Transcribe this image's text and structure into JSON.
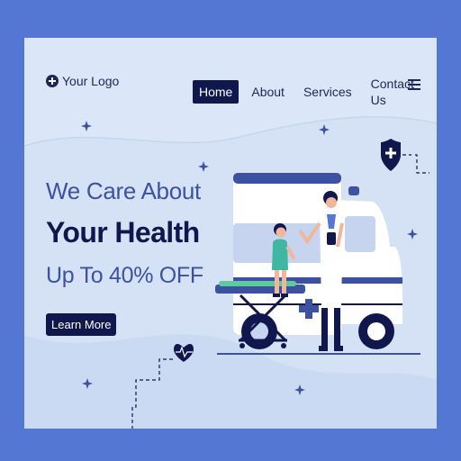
{
  "brand": {
    "logo_text": "Your Logo"
  },
  "nav": {
    "items": [
      {
        "label": "Home",
        "active": true
      },
      {
        "label": "About",
        "active": false
      },
      {
        "label": "Services",
        "active": false
      },
      {
        "label": "Contact Us",
        "active": false
      }
    ]
  },
  "hero": {
    "line1": "We Care About",
    "line2": "Your Health",
    "line3": "Up To 40% OFF",
    "cta_label": "Learn More"
  },
  "colors": {
    "frame": "#5477d4",
    "background": "#d5e2f6",
    "navy": "#10174d",
    "accent_blue": "#3d51a3"
  },
  "icons": [
    "plus-icon",
    "hamburger-menu-icon",
    "shield-plus-icon",
    "heartbeat-icon",
    "sparkle-icon"
  ]
}
